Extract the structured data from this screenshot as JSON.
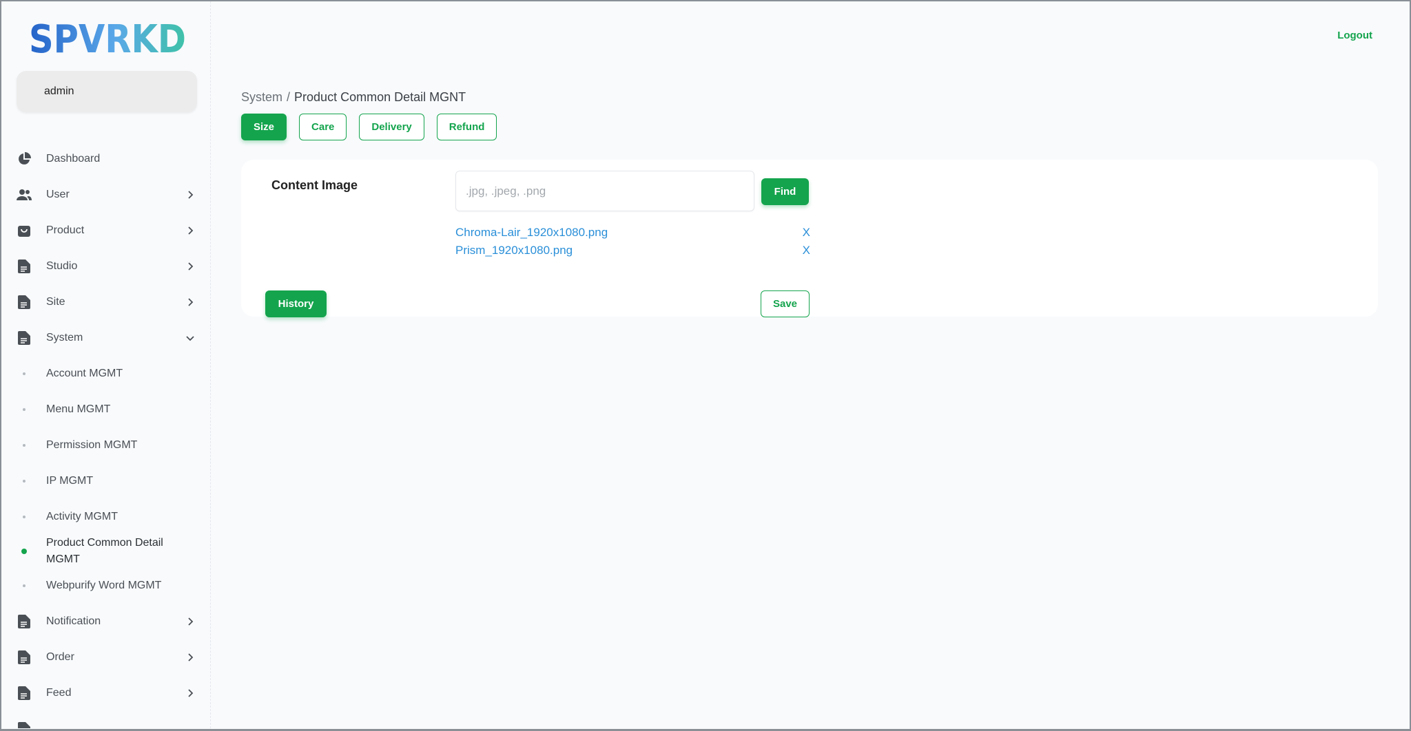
{
  "logo_text": "SPVRKD",
  "user": {
    "name": "admin"
  },
  "header": {
    "logout_label": "Logout"
  },
  "breadcrumb": {
    "parent": "System",
    "separator": "/",
    "current": "Product Common Detail MGNT"
  },
  "tabs": [
    {
      "label": "Size",
      "active": true
    },
    {
      "label": "Care",
      "active": false
    },
    {
      "label": "Delivery",
      "active": false
    },
    {
      "label": "Refund",
      "active": false
    }
  ],
  "sidebar": {
    "items": [
      {
        "label": "Dashboard",
        "icon": "pie-chart-icon",
        "chevron": "none"
      },
      {
        "label": "User",
        "icon": "users-icon",
        "chevron": "right"
      },
      {
        "label": "Product",
        "icon": "shopping-bag-icon",
        "chevron": "right"
      },
      {
        "label": "Studio",
        "icon": "document-icon",
        "chevron": "right"
      },
      {
        "label": "Site",
        "icon": "document-icon",
        "chevron": "right"
      },
      {
        "label": "System",
        "icon": "document-icon",
        "chevron": "down"
      }
    ],
    "system_sub_items": [
      {
        "label": "Account MGMT",
        "active": false
      },
      {
        "label": "Menu MGMT",
        "active": false
      },
      {
        "label": "Permission MGMT",
        "active": false
      },
      {
        "label": "IP MGMT",
        "active": false
      },
      {
        "label": "Activity MGMT",
        "active": false
      },
      {
        "label": "Product Common Detail MGMT",
        "active": true
      },
      {
        "label": "Webpurify Word MGMT",
        "active": false
      }
    ],
    "items_after": [
      {
        "label": "Notification",
        "icon": "document-icon",
        "chevron": "right"
      },
      {
        "label": "Order",
        "icon": "document-icon",
        "chevron": "right"
      },
      {
        "label": "Feed",
        "icon": "document-icon",
        "chevron": "right"
      }
    ]
  },
  "content": {
    "label": "Content Image",
    "file_input": {
      "placeholder": ".jpg, .jpeg, .png",
      "value": ""
    },
    "find_label": "Find",
    "files": [
      {
        "name": "Chroma-Lair_1920x1080.png",
        "remove_label": "X"
      },
      {
        "name": "Prism_1920x1080.png",
        "remove_label": "X"
      }
    ],
    "history_label": "History",
    "save_label": "Save"
  },
  "colors": {
    "accent": "#14a44d",
    "link": "#2a8fd8",
    "logo_gradient": [
      "#2563c9",
      "#5aa8e8",
      "#3fc2a8"
    ]
  }
}
